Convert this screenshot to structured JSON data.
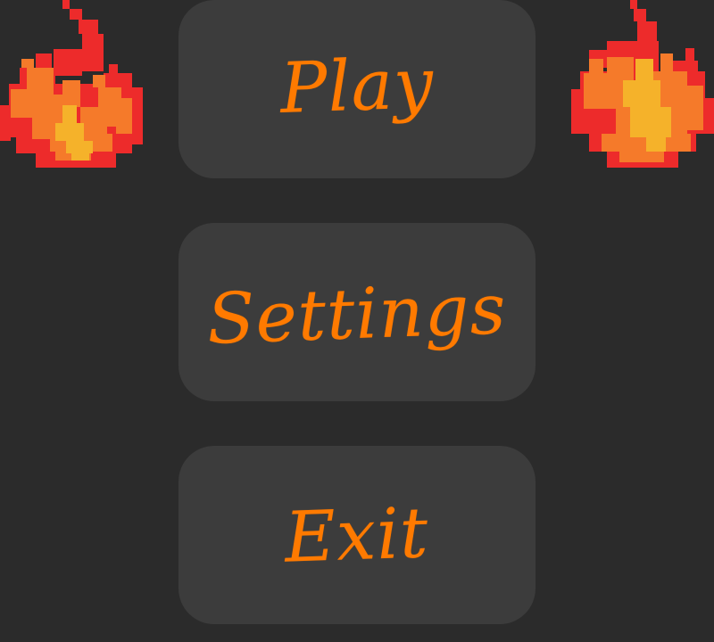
{
  "menu": {
    "play_label": "Play",
    "settings_label": "Settings",
    "exit_label": "Exit"
  },
  "decor": {
    "left_icon": "pixel-flame",
    "right_icon": "pixel-flame"
  },
  "colors": {
    "background": "#2b2b2b",
    "button": "#3c3c3c",
    "text": "#ff7a00",
    "flame_red": "#ed2b2b",
    "flame_orange": "#f57a2a",
    "flame_yellow": "#f5b22a"
  }
}
